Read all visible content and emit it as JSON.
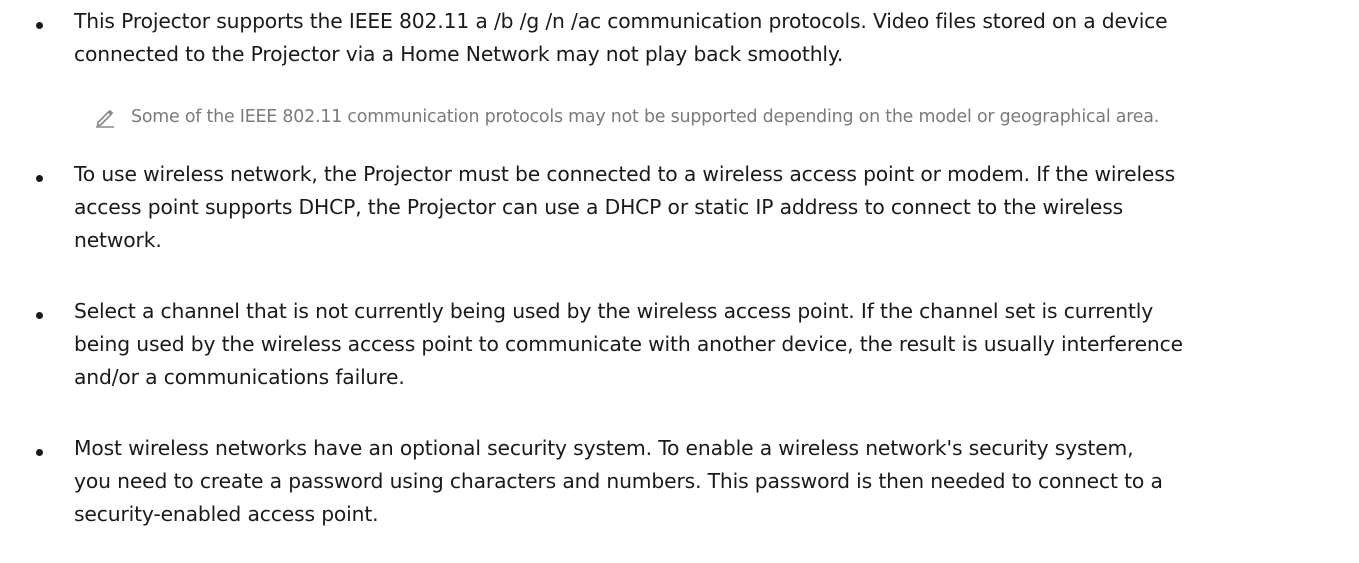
{
  "bullets": [
    {
      "lines": [
        "This Projector supports the IEEE 802.11 a /b /g /n /ac communication protocols. Video files stored on a device",
        "connected to the Projector via a Home Network may not play back smoothly."
      ]
    },
    {
      "lines": [
        "To use wireless network, the Projector must be connected to a wireless access point or modem. If the wireless",
        "access point supports DHCP, the Projector can use a DHCP or static IP address to connect to the wireless",
        "network."
      ]
    },
    {
      "lines": [
        "Select a channel that is not currently being used by the wireless access point. If the channel set is currently",
        "being used by the wireless access point to communicate with another device, the result is usually interference",
        "and/or a communications failure."
      ]
    },
    {
      "lines": [
        "Most wireless networks have an optional security system. To enable a wireless network's security system,",
        "you need to create a password using characters and numbers. This password is then needed to connect to a",
        "security-enabled access point."
      ]
    }
  ],
  "note": {
    "icon": "pencil-note-icon",
    "text": "Some of the IEEE 802.11 communication protocols may not be supported depending on the model or geographical area."
  },
  "colors": {
    "body_text": "#1a1a1a",
    "note_text": "#7a7a7a",
    "background": "#ffffff"
  }
}
